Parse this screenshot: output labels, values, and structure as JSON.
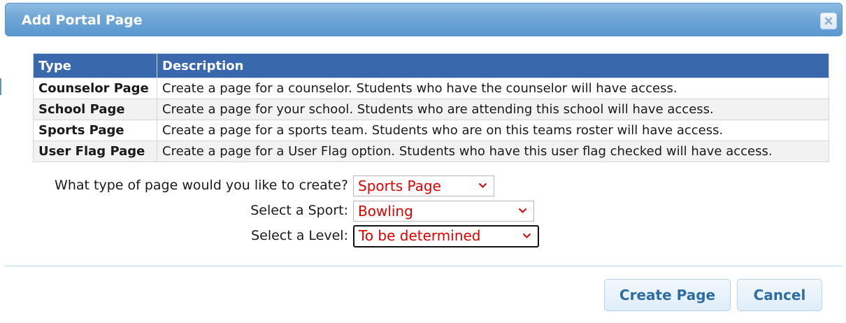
{
  "dialog": {
    "title": "Add Portal Page",
    "close_icon": "close-icon"
  },
  "table": {
    "headers": [
      "Type",
      "Description"
    ],
    "rows": [
      {
        "type": "Counselor Page",
        "description": "Create a page for a counselor. Students who have the counselor will have access."
      },
      {
        "type": "School Page",
        "description": "Create a page for your school. Students who are attending this school will have access."
      },
      {
        "type": "Sports Page",
        "description": "Create a page for a sports team. Students who are on this teams roster will have access."
      },
      {
        "type": "User Flag Page",
        "description": "Create a page for a User Flag option. Students who have this user flag checked will have access."
      }
    ]
  },
  "form": {
    "page_type": {
      "label": "What type of page would you like to create?",
      "value": "Sports Page"
    },
    "sport": {
      "label": "Select a Sport:",
      "value": "Bowling"
    },
    "level": {
      "label": "Select a Level:",
      "value": "To be determined"
    }
  },
  "buttons": {
    "create": "Create Page",
    "cancel": "Cancel"
  },
  "colors": {
    "title_bar": "#6fa6d6",
    "table_header": "#3a68ad",
    "select_text": "#e00000",
    "button_text": "#2e6da4"
  }
}
